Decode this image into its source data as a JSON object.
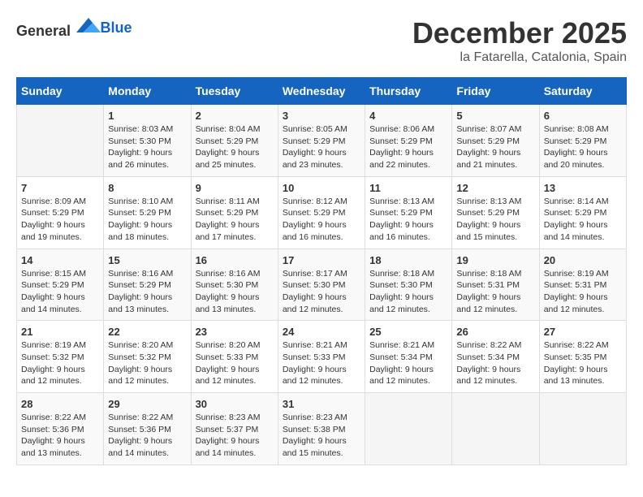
{
  "logo": {
    "text_general": "General",
    "text_blue": "Blue"
  },
  "title": {
    "month": "December 2025",
    "location": "la Fatarella, Catalonia, Spain"
  },
  "headers": [
    "Sunday",
    "Monday",
    "Tuesday",
    "Wednesday",
    "Thursday",
    "Friday",
    "Saturday"
  ],
  "weeks": [
    [
      {
        "day": "",
        "info": ""
      },
      {
        "day": "1",
        "info": "Sunrise: 8:03 AM\nSunset: 5:30 PM\nDaylight: 9 hours\nand 26 minutes."
      },
      {
        "day": "2",
        "info": "Sunrise: 8:04 AM\nSunset: 5:29 PM\nDaylight: 9 hours\nand 25 minutes."
      },
      {
        "day": "3",
        "info": "Sunrise: 8:05 AM\nSunset: 5:29 PM\nDaylight: 9 hours\nand 23 minutes."
      },
      {
        "day": "4",
        "info": "Sunrise: 8:06 AM\nSunset: 5:29 PM\nDaylight: 9 hours\nand 22 minutes."
      },
      {
        "day": "5",
        "info": "Sunrise: 8:07 AM\nSunset: 5:29 PM\nDaylight: 9 hours\nand 21 minutes."
      },
      {
        "day": "6",
        "info": "Sunrise: 8:08 AM\nSunset: 5:29 PM\nDaylight: 9 hours\nand 20 minutes."
      }
    ],
    [
      {
        "day": "7",
        "info": "Sunrise: 8:09 AM\nSunset: 5:29 PM\nDaylight: 9 hours\nand 19 minutes."
      },
      {
        "day": "8",
        "info": "Sunrise: 8:10 AM\nSunset: 5:29 PM\nDaylight: 9 hours\nand 18 minutes."
      },
      {
        "day": "9",
        "info": "Sunrise: 8:11 AM\nSunset: 5:29 PM\nDaylight: 9 hours\nand 17 minutes."
      },
      {
        "day": "10",
        "info": "Sunrise: 8:12 AM\nSunset: 5:29 PM\nDaylight: 9 hours\nand 16 minutes."
      },
      {
        "day": "11",
        "info": "Sunrise: 8:13 AM\nSunset: 5:29 PM\nDaylight: 9 hours\nand 16 minutes."
      },
      {
        "day": "12",
        "info": "Sunrise: 8:13 AM\nSunset: 5:29 PM\nDaylight: 9 hours\nand 15 minutes."
      },
      {
        "day": "13",
        "info": "Sunrise: 8:14 AM\nSunset: 5:29 PM\nDaylight: 9 hours\nand 14 minutes."
      }
    ],
    [
      {
        "day": "14",
        "info": "Sunrise: 8:15 AM\nSunset: 5:29 PM\nDaylight: 9 hours\nand 14 minutes."
      },
      {
        "day": "15",
        "info": "Sunrise: 8:16 AM\nSunset: 5:29 PM\nDaylight: 9 hours\nand 13 minutes."
      },
      {
        "day": "16",
        "info": "Sunrise: 8:16 AM\nSunset: 5:30 PM\nDaylight: 9 hours\nand 13 minutes."
      },
      {
        "day": "17",
        "info": "Sunrise: 8:17 AM\nSunset: 5:30 PM\nDaylight: 9 hours\nand 12 minutes."
      },
      {
        "day": "18",
        "info": "Sunrise: 8:18 AM\nSunset: 5:30 PM\nDaylight: 9 hours\nand 12 minutes."
      },
      {
        "day": "19",
        "info": "Sunrise: 8:18 AM\nSunset: 5:31 PM\nDaylight: 9 hours\nand 12 minutes."
      },
      {
        "day": "20",
        "info": "Sunrise: 8:19 AM\nSunset: 5:31 PM\nDaylight: 9 hours\nand 12 minutes."
      }
    ],
    [
      {
        "day": "21",
        "info": "Sunrise: 8:19 AM\nSunset: 5:32 PM\nDaylight: 9 hours\nand 12 minutes."
      },
      {
        "day": "22",
        "info": "Sunrise: 8:20 AM\nSunset: 5:32 PM\nDaylight: 9 hours\nand 12 minutes."
      },
      {
        "day": "23",
        "info": "Sunrise: 8:20 AM\nSunset: 5:33 PM\nDaylight: 9 hours\nand 12 minutes."
      },
      {
        "day": "24",
        "info": "Sunrise: 8:21 AM\nSunset: 5:33 PM\nDaylight: 9 hours\nand 12 minutes."
      },
      {
        "day": "25",
        "info": "Sunrise: 8:21 AM\nSunset: 5:34 PM\nDaylight: 9 hours\nand 12 minutes."
      },
      {
        "day": "26",
        "info": "Sunrise: 8:22 AM\nSunset: 5:34 PM\nDaylight: 9 hours\nand 12 minutes."
      },
      {
        "day": "27",
        "info": "Sunrise: 8:22 AM\nSunset: 5:35 PM\nDaylight: 9 hours\nand 13 minutes."
      }
    ],
    [
      {
        "day": "28",
        "info": "Sunrise: 8:22 AM\nSunset: 5:36 PM\nDaylight: 9 hours\nand 13 minutes."
      },
      {
        "day": "29",
        "info": "Sunrise: 8:22 AM\nSunset: 5:36 PM\nDaylight: 9 hours\nand 14 minutes."
      },
      {
        "day": "30",
        "info": "Sunrise: 8:23 AM\nSunset: 5:37 PM\nDaylight: 9 hours\nand 14 minutes."
      },
      {
        "day": "31",
        "info": "Sunrise: 8:23 AM\nSunset: 5:38 PM\nDaylight: 9 hours\nand 15 minutes."
      },
      {
        "day": "",
        "info": ""
      },
      {
        "day": "",
        "info": ""
      },
      {
        "day": "",
        "info": ""
      }
    ]
  ]
}
